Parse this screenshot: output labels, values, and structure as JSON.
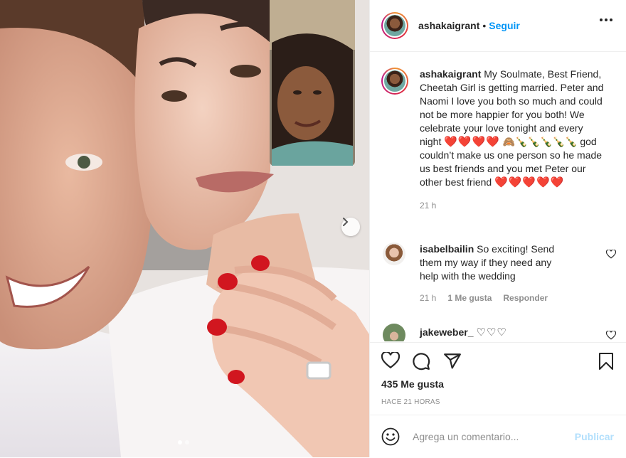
{
  "post": {
    "username": "ashakaigrant",
    "follow_label": "Seguir",
    "caption": "My Soulmate, Best Friend, Cheetah Girl is getting married. Peter and Naomi I love you both so much and could not be more happier for you both! We celebrate your love tonight and every night",
    "caption_hearts_1": "❤️❤️❤️❤️",
    "caption_emojis_2": "🙈🍾🍾🍾🍾🍾",
    "caption_part_2": "god couldn’t make us one person so he made us best friends and you met Peter our other best friend",
    "caption_hearts_2": "❤️❤️❤️❤️❤️",
    "caption_time": "21 h",
    "likes": "435 Me gusta",
    "posted_ago": "HACE 21 HORAS"
  },
  "comments": [
    {
      "username": "isabelbailin",
      "text": "So exciting! Send them my way if they need any help with the wedding",
      "time": "21 h",
      "likes": "1 Me gusta",
      "reply_label": "Responder"
    },
    {
      "username": "jakeweber_",
      "text": "♡♡♡"
    }
  ],
  "add_comment": {
    "placeholder": "Agrega un comentario...",
    "publish_label": "Publicar"
  },
  "icons": {
    "more": "more-options-icon",
    "next": "chevron-right-icon",
    "like": "heart-outline-icon",
    "comment": "comment-bubble-icon",
    "share": "paper-plane-icon",
    "save": "bookmark-icon",
    "emoji": "smiley-icon"
  },
  "colors": {
    "accent": "#0095f6",
    "publish_disabled": "#b2dffc",
    "muted": "#8e8e8e",
    "heart_red": "#ed1c24"
  },
  "carousel": {
    "slides": 2,
    "active": 1
  }
}
